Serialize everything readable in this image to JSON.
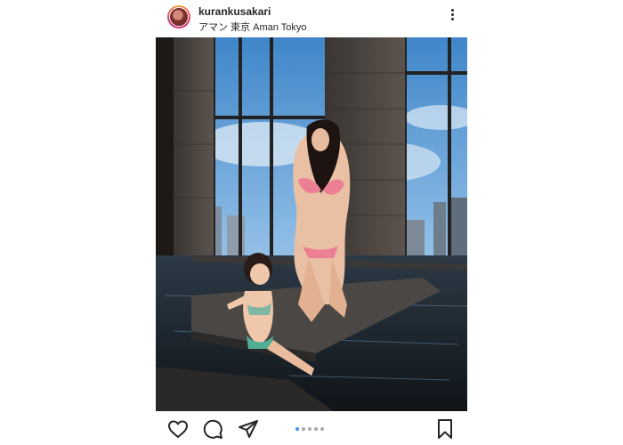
{
  "post": {
    "username": "kurankusakari",
    "location": "アマン 東京 Aman Tokyo"
  },
  "carousel": {
    "total": 5,
    "active_index": 0,
    "active_color": "#3897f0",
    "inactive_color": "#a8a8a8"
  },
  "icons": {
    "like": "heart-icon",
    "comment": "comment-icon",
    "share": "send-icon",
    "save": "bookmark-icon",
    "more": "more-icon"
  }
}
